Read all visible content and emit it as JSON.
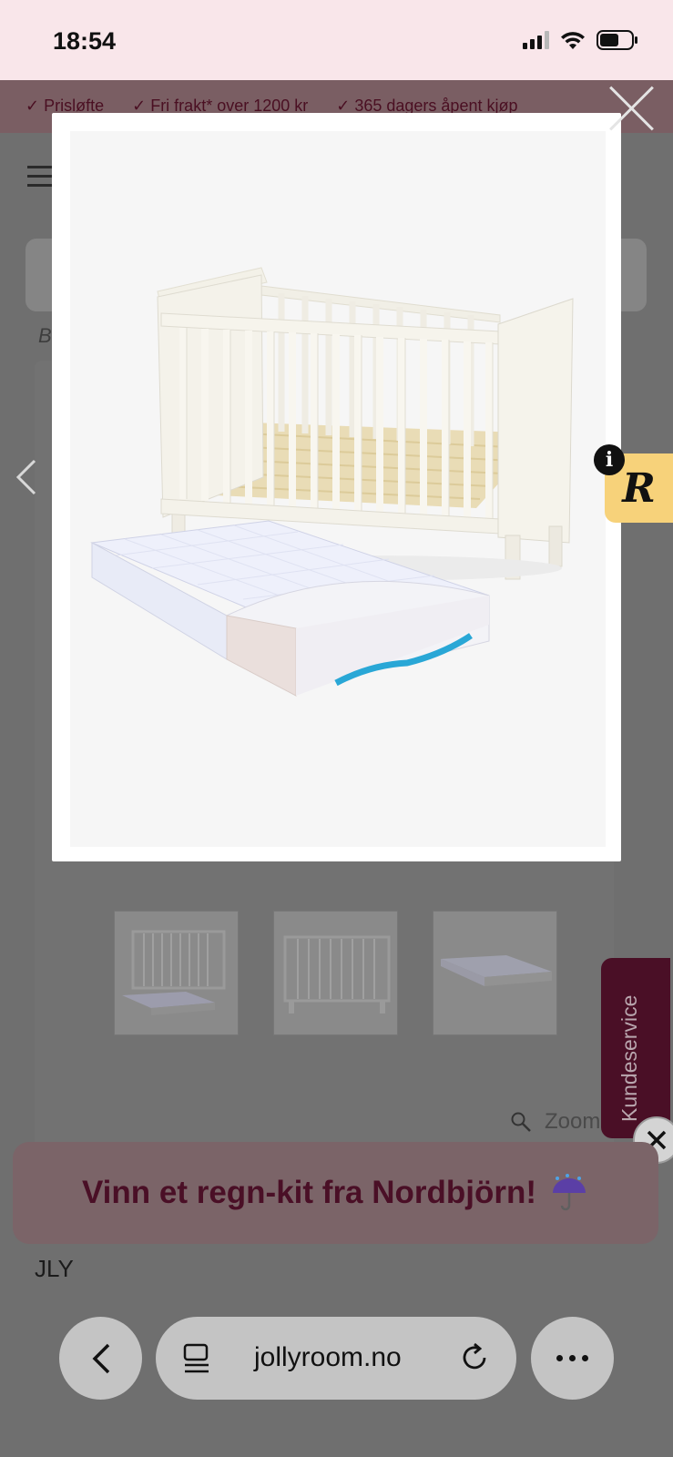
{
  "status_bar": {
    "time": "18:54"
  },
  "page": {
    "usp_items": [
      "✓ Prisløfte",
      "✓ Fri frakt* over 1200 kr",
      "✓ 365 dagers åpent kjøp"
    ],
    "breadcrumb_initial": "B",
    "zoom_label": "Zoom",
    "brand": "JLY",
    "kundeservice_label": "Kundeservice"
  },
  "promo": {
    "text": "Vinn et regn-kit fra Nordbjörn!"
  },
  "badge": {
    "letter": "R",
    "info": "i"
  },
  "browser": {
    "url": "jollyroom.no"
  },
  "colors": {
    "brand_wine": "#4a0f26",
    "status_bg": "#f9e6ea",
    "badge_yellow": "#f7d27a"
  }
}
